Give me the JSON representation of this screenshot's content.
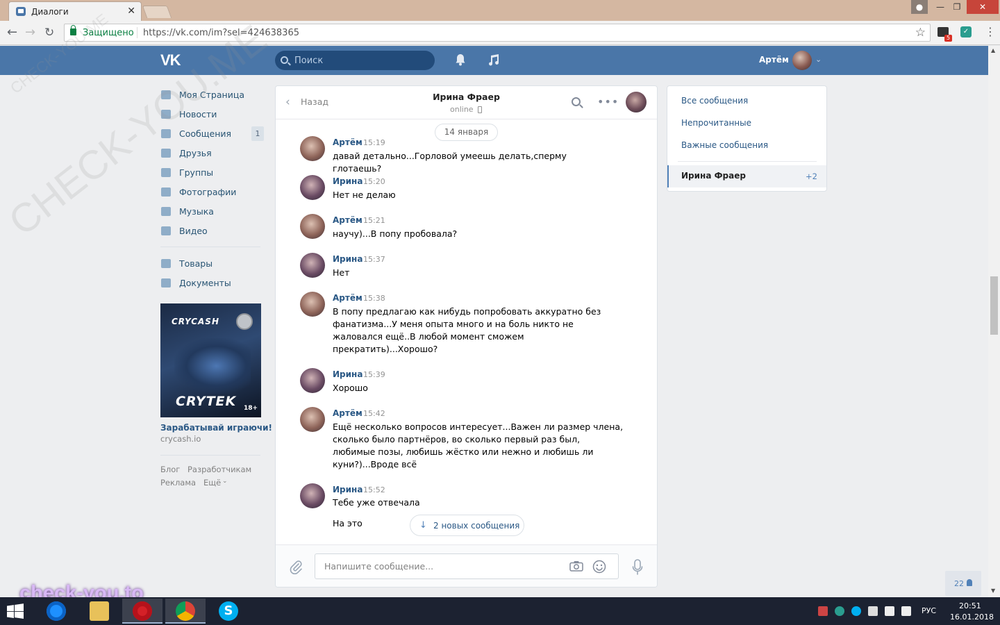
{
  "browser": {
    "tab_title": "Диалоги",
    "secure_label": "Защищено",
    "url": "https://vk.com/im?sel=424638365",
    "extension_badge": "5"
  },
  "header": {
    "logo": "VK",
    "search_placeholder": "Поиск",
    "user_name": "Артём"
  },
  "sidebar": {
    "items": [
      {
        "label": "Моя Страница",
        "icon": "home-icon"
      },
      {
        "label": "Новости",
        "icon": "news-icon"
      },
      {
        "label": "Сообщения",
        "icon": "messages-icon",
        "counter": "1"
      },
      {
        "label": "Друзья",
        "icon": "friends-icon"
      },
      {
        "label": "Группы",
        "icon": "groups-icon"
      },
      {
        "label": "Фотографии",
        "icon": "photos-icon"
      },
      {
        "label": "Музыка",
        "icon": "music-icon"
      },
      {
        "label": "Видео",
        "icon": "video-icon"
      }
    ],
    "items2": [
      {
        "label": "Товары",
        "icon": "goods-icon"
      },
      {
        "label": "Документы",
        "icon": "documents-icon"
      }
    ],
    "ad": {
      "logo_top": "CRYCASH",
      "logo_bottom": "CRYTEK",
      "age": "18+",
      "title": "Зарабатывай играючи!",
      "domain": "crycash.io"
    },
    "footer": {
      "blog": "Блог",
      "developers": "Разработчикам",
      "ads": "Реклама",
      "more": "Ещё"
    }
  },
  "chat": {
    "back_label": "Назад",
    "peer_name": "Ирина Фраер",
    "peer_status": "online",
    "date": "14 января",
    "messages": [
      {
        "author": "Артём",
        "time": "15:19",
        "text": "давай детально...Горловой умеешь делать,сперму глотаешь?"
      },
      {
        "author": "Ирина",
        "time": "15:20",
        "text": "Нет не делаю"
      },
      {
        "author": "Артём",
        "time": "15:21",
        "text": "научу)...В попу пробовала?"
      },
      {
        "author": "Ирина",
        "time": "15:37",
        "text": "Нет"
      },
      {
        "author": "Артём",
        "time": "15:38",
        "text": "В попу предлагаю как нибудь попробовать аккуратно без\nфанатизма...У меня опыта много и на боль никто не\nжаловался ещё..В любой момент сможем\nпрекратить)...Хорошо?"
      },
      {
        "author": "Ирина",
        "time": "15:39",
        "text": "Хорошо"
      },
      {
        "author": "Артём",
        "time": "15:42",
        "text": "Ещё несколько вопросов интересует...Важен ли размер члена,\nсколько было партнёров, во сколько первый раз был,\nлюбимые позы, любишь жёстко или нежно и любишь ли\nкуни?)...Вроде всё"
      },
      {
        "author": "Ирина",
        "time": "15:52",
        "text": "Тебе уже отвечала\n\nНа это"
      }
    ],
    "new_messages_label": "2 новых сообщения",
    "input_placeholder": "Напишите сообщение..."
  },
  "right_panel": {
    "filters": [
      "Все сообщения",
      "Непрочитанные",
      "Важные сообщения"
    ],
    "active_conversation": {
      "name": "Ирина Фраер",
      "count": "+2"
    }
  },
  "online_widget": {
    "count": "22"
  },
  "watermarks": {
    "big": "CHECK-YOU.ME",
    "small": "CHECK-YOU.ME",
    "bottom": "check-you.to"
  },
  "taskbar": {
    "lang": "РУС",
    "time": "20:51",
    "date": "16.01.2018"
  },
  "colors": {
    "vk_blue": "#4a76a8",
    "link": "#2a5885",
    "page_bg": "#edeef0",
    "taskbar": "#1c2231"
  }
}
